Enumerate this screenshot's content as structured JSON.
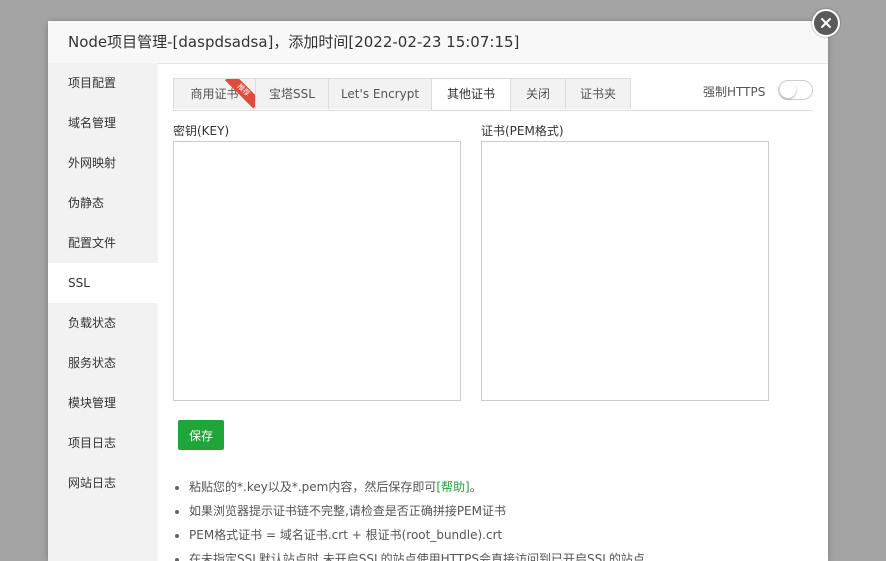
{
  "dialog": {
    "title": "Node项目管理-[daspdsadsa]，添加时间[2022-02-23 15:07:15]"
  },
  "sidebar": {
    "items": [
      {
        "label": "项目配置"
      },
      {
        "label": "域名管理"
      },
      {
        "label": "外网映射"
      },
      {
        "label": "伪静态"
      },
      {
        "label": "配置文件"
      },
      {
        "label": "SSL",
        "active": true
      },
      {
        "label": "负载状态"
      },
      {
        "label": "服务状态"
      },
      {
        "label": "模块管理"
      },
      {
        "label": "项目日志"
      },
      {
        "label": "网站日志"
      }
    ]
  },
  "tabs": [
    {
      "label": "商用证书",
      "badge": "推荐"
    },
    {
      "label": "宝塔SSL"
    },
    {
      "label": "Let's Encrypt"
    },
    {
      "label": "其他证书",
      "active": true
    },
    {
      "label": "关闭"
    },
    {
      "label": "证书夹"
    }
  ],
  "https": {
    "label": "强制HTTPS",
    "enabled": false
  },
  "key_field": {
    "label": "密钥(KEY)",
    "value": ""
  },
  "cert_field": {
    "label": "证书(PEM格式)",
    "value": ""
  },
  "save_label": "保存",
  "tips": {
    "tip1_prefix": "粘贴您的*.key以及*.pem内容，然后保存即可",
    "tip1_link": "[帮助]",
    "tip1_suffix": "。",
    "tip2": "如果浏览器提示证书链不完整,请检查是否正确拼接PEM证书",
    "tip3": "PEM格式证书 = 域名证书.crt + 根证书(root_bundle).crt",
    "tip4": "在未指定SSL默认站点时,未开启SSL的站点使用HTTPS会直接访问到已开启SSL的站点"
  },
  "colors": {
    "accent": "#20a53a",
    "ribbon": "#e14b3b",
    "overlay": "#a4a4a4"
  }
}
